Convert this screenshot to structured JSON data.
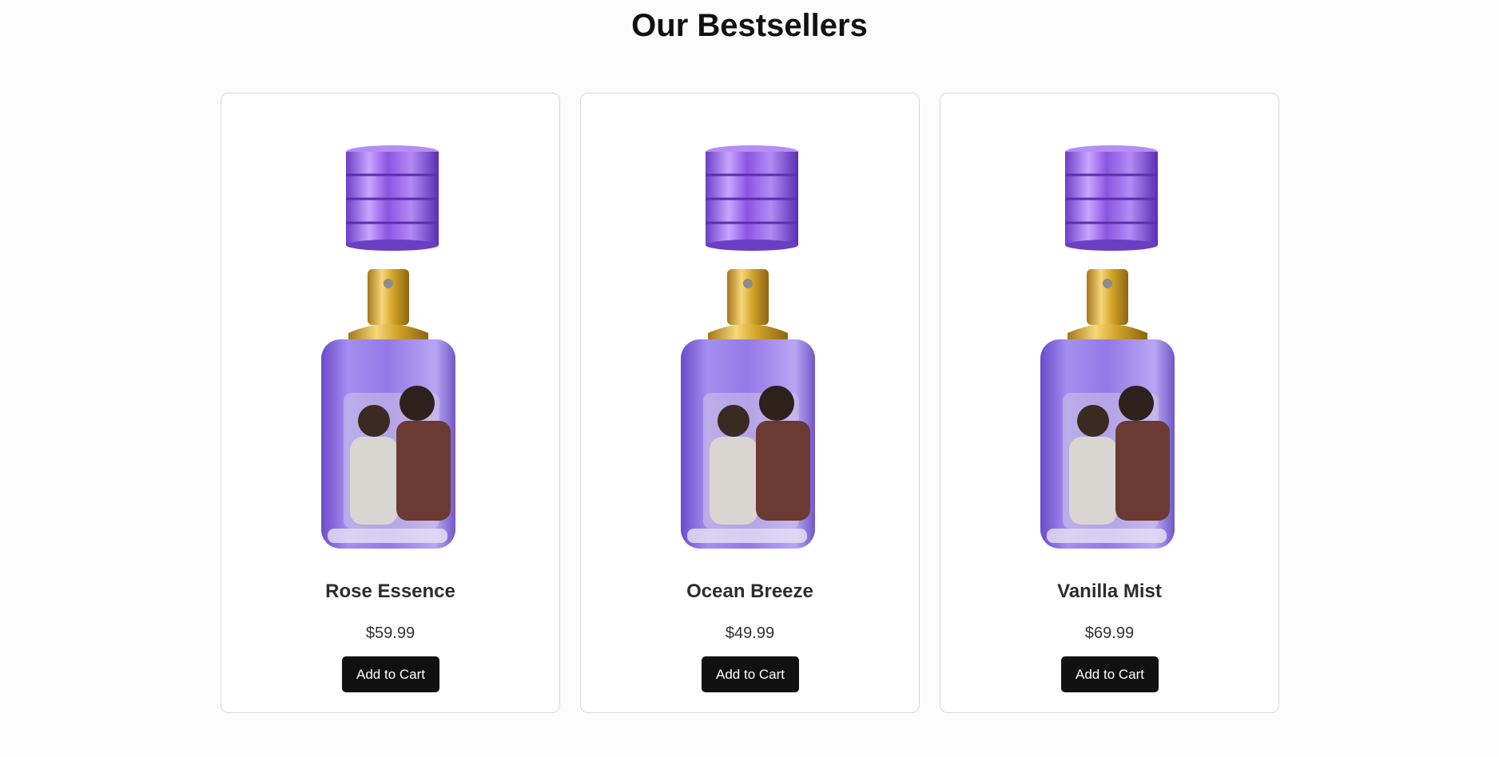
{
  "header": {
    "title": "Our Bestsellers"
  },
  "products": [
    {
      "name": "Rose Essence",
      "price": "$59.99",
      "button_label": "Add to Cart"
    },
    {
      "name": "Ocean Breeze",
      "price": "$49.99",
      "button_label": "Add to Cart"
    },
    {
      "name": "Vanilla Mist",
      "price": "$69.99",
      "button_label": "Add to Cart"
    }
  ],
  "colors": {
    "background": "#fcfcfc",
    "card_border": "#d9d9d9",
    "button": "#111111",
    "bottle_purple": "#8e6ee0",
    "cap_purple": "#9b6be8",
    "nozzle_gold": "#d4a62a"
  },
  "icons": {
    "product_image": "perfume-bottle-image"
  }
}
